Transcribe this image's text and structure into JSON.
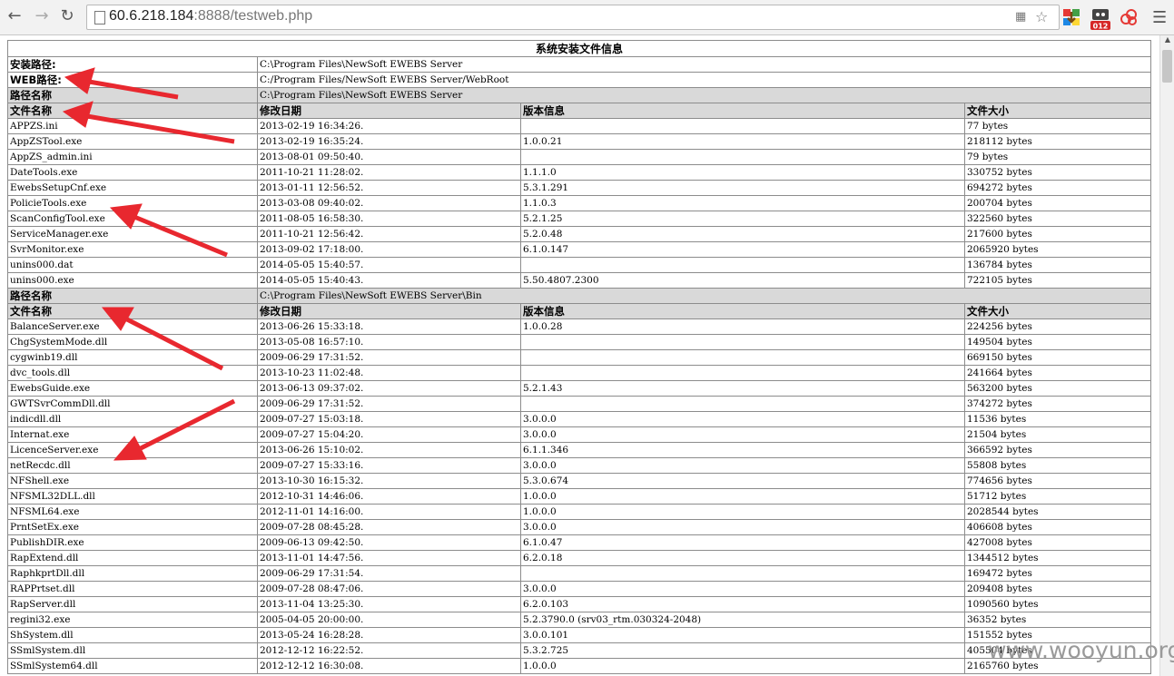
{
  "browser": {
    "url_host": "60.6.218.184",
    "url_rest": ":8888/testweb.php",
    "extension_badge": "012"
  },
  "table": {
    "title": "系统安装文件信息",
    "install_label": "安装路径:",
    "install_path": "C:\\Program Files\\NewSoft EWEBS Server",
    "web_label": "WEB路径:",
    "web_path": "C:/Program Files/NewSoft EWEBS Server/WebRoot",
    "sections": [
      {
        "path_label": "路径名称",
        "path": "C:\\Program Files\\NewSoft EWEBS Server",
        "headers": [
          "文件名称",
          "修改日期",
          "版本信息",
          "文件大小"
        ],
        "rows": [
          [
            "APPZS.ini",
            "2013-02-19 16:34:26.",
            "",
            "77 bytes"
          ],
          [
            "AppZSTool.exe",
            "2013-02-19 16:35:24.",
            "1.0.0.21",
            "218112 bytes"
          ],
          [
            "AppZS_admin.ini",
            "2013-08-01 09:50:40.",
            "",
            "79 bytes"
          ],
          [
            "DateTools.exe",
            "2011-10-21 11:28:02.",
            "1.1.1.0",
            "330752 bytes"
          ],
          [
            "EwebsSetupCnf.exe",
            "2013-01-11 12:56:52.",
            "5.3.1.291",
            "694272 bytes"
          ],
          [
            "PolicieTools.exe",
            "2013-03-08 09:40:02.",
            "1.1.0.3",
            "200704 bytes"
          ],
          [
            "ScanConfigTool.exe",
            "2011-08-05 16:58:30.",
            "5.2.1.25",
            "322560 bytes"
          ],
          [
            "ServiceManager.exe",
            "2011-10-21 12:56:42.",
            "5.2.0.48",
            "217600 bytes"
          ],
          [
            "SvrMonitor.exe",
            "2013-09-02 17:18:00.",
            "6.1.0.147",
            "2065920 bytes"
          ],
          [
            "unins000.dat",
            "2014-05-05 15:40:57.",
            "",
            "136784 bytes"
          ],
          [
            "unins000.exe",
            "2014-05-05 15:40:43.",
            "5.50.4807.2300",
            "722105 bytes"
          ]
        ]
      },
      {
        "path_label": "路径名称",
        "path": "C:\\Program Files\\NewSoft EWEBS Server\\Bin",
        "headers": [
          "文件名称",
          "修改日期",
          "版本信息",
          "文件大小"
        ],
        "rows": [
          [
            "BalanceServer.exe",
            "2013-06-26 15:33:18.",
            "1.0.0.28",
            "224256 bytes"
          ],
          [
            "ChgSystemMode.dll",
            "2013-05-08 16:57:10.",
            "",
            "149504 bytes"
          ],
          [
            "cygwinb19.dll",
            "2009-06-29 17:31:52.",
            "",
            "669150 bytes"
          ],
          [
            "dvc_tools.dll",
            "2013-10-23 11:02:48.",
            "",
            "241664 bytes"
          ],
          [
            "EwebsGuide.exe",
            "2013-06-13 09:37:02.",
            "5.2.1.43",
            "563200 bytes"
          ],
          [
            "GWTSvrCommDll.dll",
            "2009-06-29 17:31:52.",
            "",
            "374272 bytes"
          ],
          [
            "indicdll.dll",
            "2009-07-27 15:03:18.",
            "3.0.0.0",
            "11536 bytes"
          ],
          [
            "Internat.exe",
            "2009-07-27 15:04:20.",
            "3.0.0.0",
            "21504 bytes"
          ],
          [
            "LicenceServer.exe",
            "2013-06-26 15:10:02.",
            "6.1.1.346",
            "366592 bytes"
          ],
          [
            "netRecdc.dll",
            "2009-07-27 15:33:16.",
            "3.0.0.0",
            "55808 bytes"
          ],
          [
            "NFShell.exe",
            "2013-10-30 16:15:32.",
            "5.3.0.674",
            "774656 bytes"
          ],
          [
            "NFSML32DLL.dll",
            "2012-10-31 14:46:06.",
            "1.0.0.0",
            "51712 bytes"
          ],
          [
            "NFSML64.exe",
            "2012-11-01 14:16:00.",
            "1.0.0.0",
            "2028544 bytes"
          ],
          [
            "PrntSetEx.exe",
            "2009-07-28 08:45:28.",
            "3.0.0.0",
            "406608 bytes"
          ],
          [
            "PublishDIR.exe",
            "2009-06-13 09:42:50.",
            "6.1.0.47",
            "427008 bytes"
          ],
          [
            "RapExtend.dll",
            "2013-11-01 14:47:56.",
            "6.2.0.18",
            "1344512 bytes"
          ],
          [
            "RaphkprtDll.dll",
            "2009-06-29 17:31:54.",
            "",
            "169472 bytes"
          ],
          [
            "RAPPrtset.dll",
            "2009-07-28 08:47:06.",
            "3.0.0.0",
            "209408 bytes"
          ],
          [
            "RapServer.dll",
            "2013-11-04 13:25:30.",
            "6.2.0.103",
            "1090560 bytes"
          ],
          [
            "regini32.exe",
            "2005-04-05 20:00:00.",
            "5.2.3790.0 (srv03_rtm.030324-2048)",
            "36352 bytes"
          ],
          [
            "ShSystem.dll",
            "2013-05-24 16:28:28.",
            "3.0.0.101",
            "151552 bytes"
          ],
          [
            "SSmlSystem.dll",
            "2012-12-12 16:22:52.",
            "5.3.2.725",
            "405504 bytes"
          ],
          [
            "SSmlSystem64.dll",
            "2012-12-12 16:30:08.",
            "1.0.0.0",
            "2165760 bytes"
          ]
        ]
      }
    ]
  },
  "watermark": "www.wooyun.org",
  "colors": {
    "arrow": "#e8282f",
    "header_row": "#d9d9d9"
  }
}
